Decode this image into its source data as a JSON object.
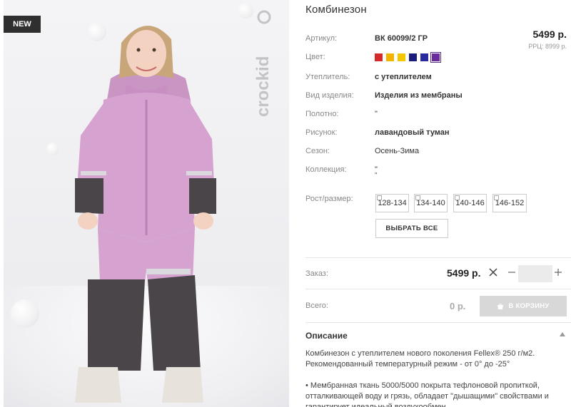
{
  "badge": "NEW",
  "brand": "crockid",
  "product": {
    "title": "Комбинезон",
    "price": "5499 р.",
    "rrp": "РРЦ: 8999 р."
  },
  "attributes": [
    {
      "label": "Артикул:",
      "value": "ВК 60099/2 ГР"
    },
    {
      "label": "Цвет:",
      "value": ""
    },
    {
      "label": "Утеплитель:",
      "value": "с утеплителем"
    },
    {
      "label": "Вид изделия:",
      "value": "Изделия из мембраны"
    },
    {
      "label": "Полотно:",
      "value": "\""
    },
    {
      "label": "Рисунок:",
      "value": "лавандовый туман"
    },
    {
      "label": "Сезон:",
      "value": "Осень-Зима"
    },
    {
      "label": "Коллекция:",
      "value": "\""
    },
    {
      "label": "Рост/размер:",
      "value": ""
    }
  ],
  "collection_value_2": "\"",
  "colors": [
    "#d42a2a",
    "#f3b400",
    "#f3c600",
    "#1c1c7a",
    "#2a2aa0",
    "#6a2b9c"
  ],
  "selected_color_index": 5,
  "sizes": [
    "128-134",
    "134-140",
    "140-146",
    "146-152"
  ],
  "select_all_label": "ВЫБРАТЬ ВСЕ",
  "order": {
    "label": "Заказ:",
    "price": "5499 р.",
    "quantity": "",
    "total_label": "Всего:",
    "total": "0 р.",
    "cart_label": "В КОРЗИНУ"
  },
  "description": {
    "title": "Описание",
    "p1": "Комбинезон с утеплителем нового поколения Fellex® 250 г/м2. Рекомендованный температурный режим - от 0° до -25°",
    "p2": "• Мембранная ткань 5000/5000 покрыта тефлоновой пропиткой, отталкивающей воду и грязь, обладает \"дышащими\" свойствами и гарантирует идеальный воздухообмен"
  }
}
